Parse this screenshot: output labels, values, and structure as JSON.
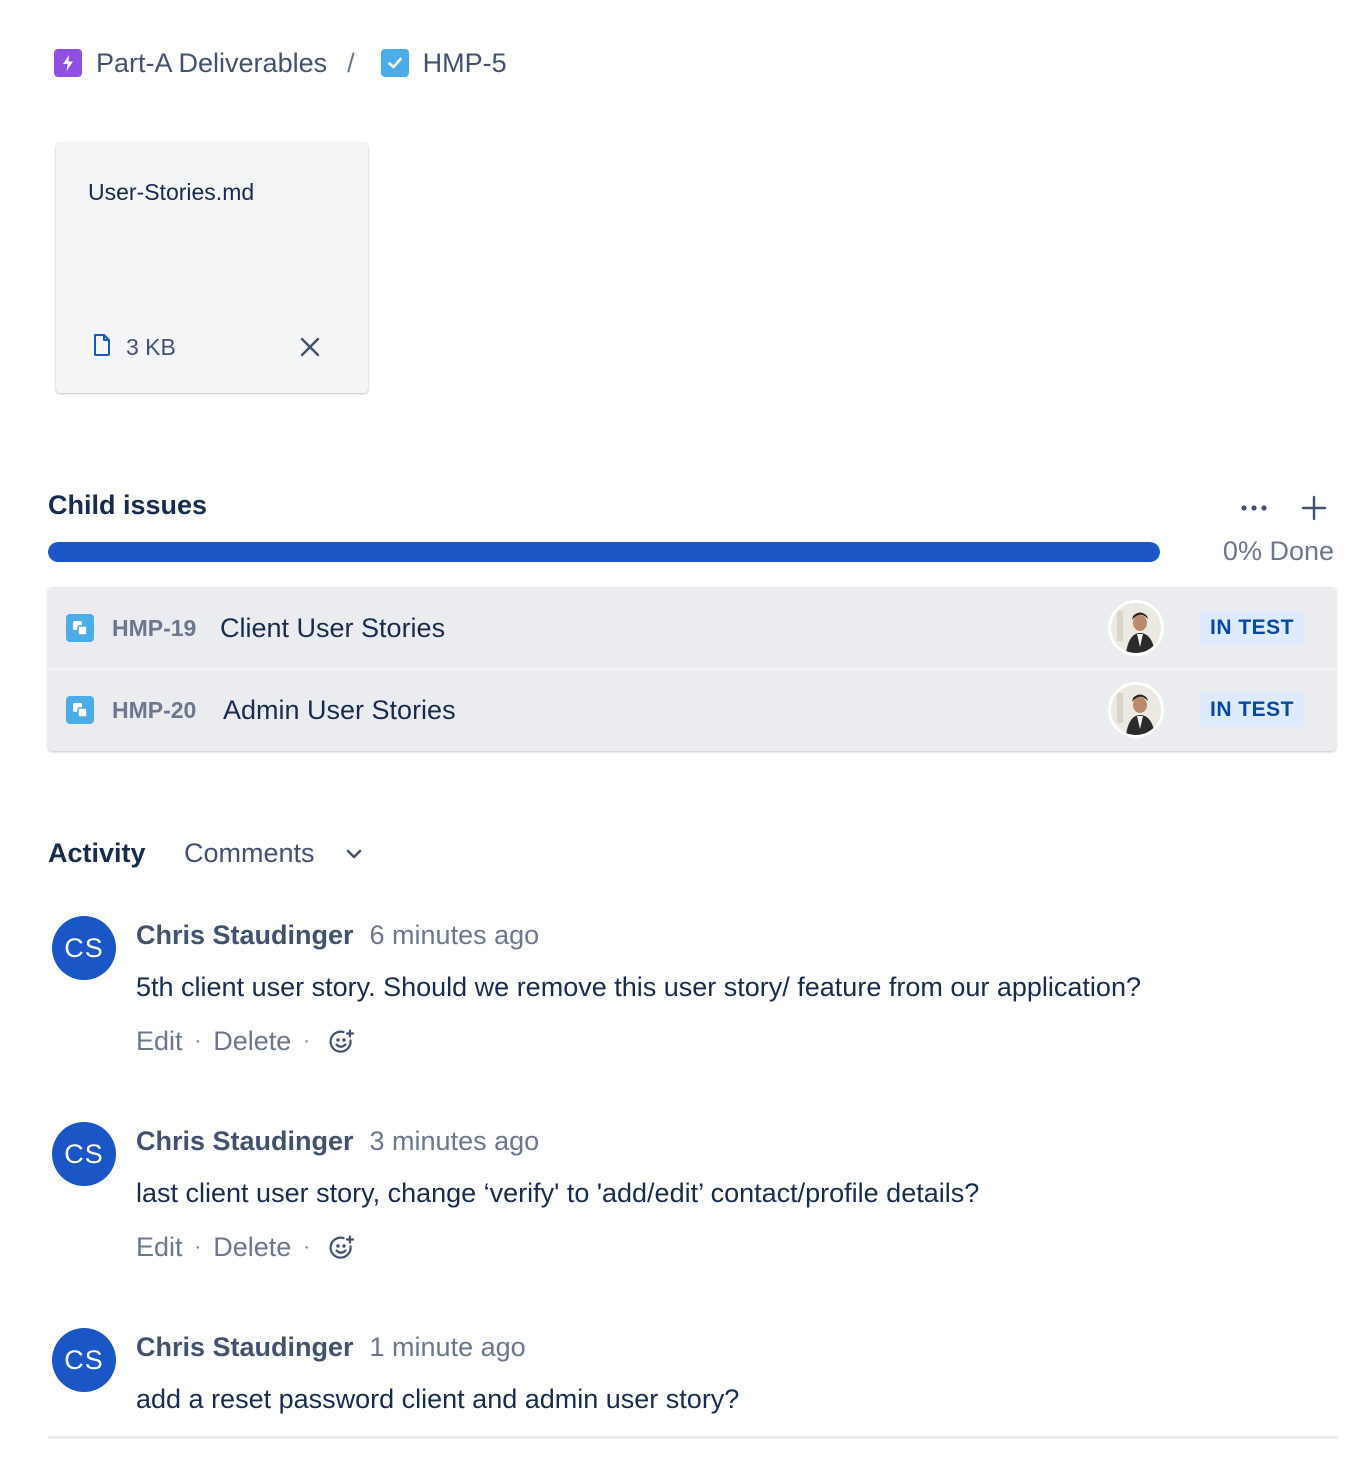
{
  "breadcrumb": {
    "items": [
      {
        "label": "Part-A Deliverables",
        "icon": "epic-icon"
      },
      {
        "label": "HMP-5",
        "icon": "task-checkbox-icon"
      }
    ],
    "separator": "/"
  },
  "attachment": {
    "file_name": "User-Stories.md",
    "size": "3 KB",
    "file_icon": "document-icon",
    "remove_icon": "close-icon"
  },
  "child_issues": {
    "title": "Child issues",
    "progress_percent": 0,
    "progress_label": "0% Done",
    "colors": {
      "progress_fill": "#1a56c6",
      "status_bg": "#deebff",
      "status_text": "#0747a6"
    },
    "items": [
      {
        "key": "HMP-19",
        "summary": "Client User Stories",
        "status": "IN TEST",
        "icon": "subtask-icon"
      },
      {
        "key": "HMP-20",
        "summary": "Admin User Stories",
        "status": "IN TEST",
        "icon": "subtask-icon"
      }
    ]
  },
  "activity": {
    "title": "Activity",
    "filter": "Comments",
    "comments": [
      {
        "initials": "CS",
        "author": "Chris Staudinger",
        "time": "6 minutes ago",
        "body": "5th client user story. Should we remove this user story/ feature from our application?",
        "actions": {
          "edit": "Edit",
          "delete": "Delete"
        }
      },
      {
        "initials": "CS",
        "author": "Chris Staudinger",
        "time": "3 minutes ago",
        "body": "last client user story, change ‘verify' to 'add/edit’ contact/profile details?",
        "actions": {
          "edit": "Edit",
          "delete": "Delete"
        }
      },
      {
        "initials": "CS",
        "author": "Chris Staudinger",
        "time": "1 minute ago",
        "body": "add a reset password client and admin user story?"
      }
    ]
  }
}
